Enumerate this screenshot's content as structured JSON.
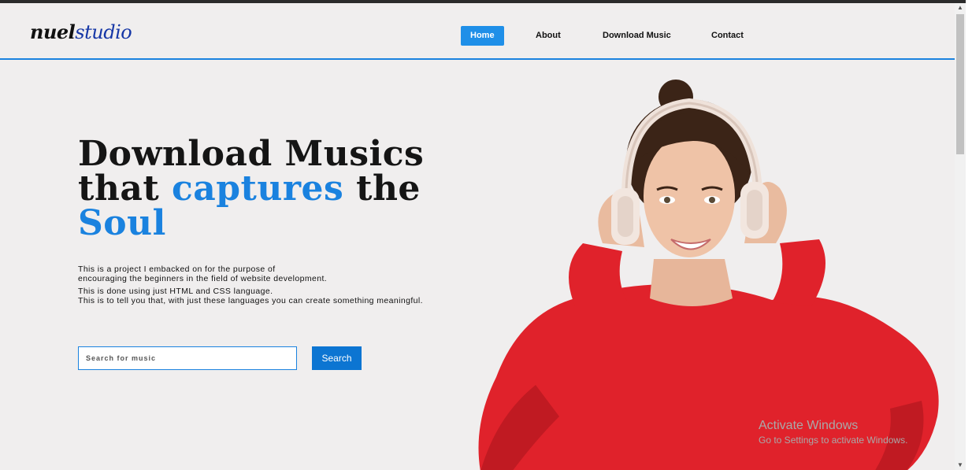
{
  "logo": {
    "part1": "nuel",
    "part2": "studio"
  },
  "nav": {
    "items": [
      {
        "label": "Home"
      },
      {
        "label": "About"
      },
      {
        "label": "Download Music"
      },
      {
        "label": "Contact"
      }
    ],
    "active": "Home"
  },
  "hero": {
    "title_line1": "Download Musics",
    "title_line2_pre": "that ",
    "title_line2_accent": "captures",
    "title_line2_post": " the",
    "title_line3_accent": "Soul",
    "paragraph1_line1": "This is a project I embacked on for the purpose of",
    "paragraph1_line2": "encouraging the beginners in the field of website development.",
    "paragraph2_line1": "This is done using just HTML and CSS language.",
    "paragraph2_line2": "This is to tell you that, with just these languages you can create something meaningful."
  },
  "search": {
    "placeholder": "Search for music",
    "value": "",
    "button_label": "Search"
  },
  "watermark": {
    "line1": "Activate Windows",
    "line2": "Go to Settings to activate Windows."
  },
  "colors": {
    "accent": "#1a82df",
    "background": "#f0eeee",
    "sweater": "#e0222b"
  }
}
